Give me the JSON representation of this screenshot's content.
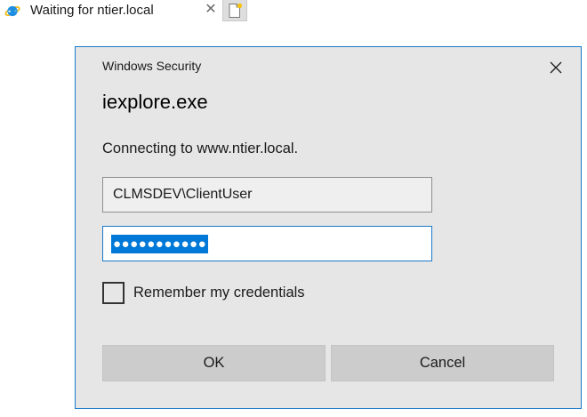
{
  "browser": {
    "tab_title": "Waiting for ntier.local",
    "tab_icon": "ie-icon",
    "tab_close": "✕",
    "new_tab_icon": "new-tab-icon"
  },
  "dialog": {
    "caption": "Windows Security",
    "heading": "iexplore.exe",
    "message": "Connecting to www.ntier.local.",
    "username_value": "CLMSDEV\\ClientUser",
    "password_masked": "●●●●●●●●●●●",
    "remember_label": "Remember my credentials",
    "remember_checked": false,
    "ok_label": "OK",
    "cancel_label": "Cancel"
  },
  "colors": {
    "accent": "#0078d7",
    "dialog_bg": "#e6e6e6",
    "button_bg": "#cccccc"
  }
}
